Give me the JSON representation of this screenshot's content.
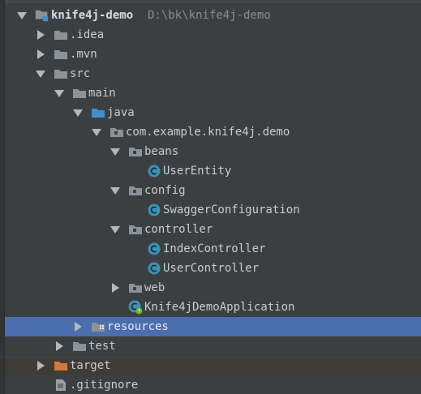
{
  "project": {
    "name": "knife4j-demo",
    "path": "D:\\bk\\knife4j-demo"
  },
  "tree": [
    {
      "label": "knife4j-demo",
      "level": 0,
      "toggle": "down",
      "icon": "module-folder-icon"
    },
    {
      "label": ".idea",
      "level": 1,
      "toggle": "right",
      "icon": "folder-icon"
    },
    {
      "label": ".mvn",
      "level": 1,
      "toggle": "right",
      "icon": "folder-icon"
    },
    {
      "label": "src",
      "level": 1,
      "toggle": "down",
      "icon": "folder-icon"
    },
    {
      "label": "main",
      "level": 2,
      "toggle": "down",
      "icon": "folder-icon"
    },
    {
      "label": "java",
      "level": 3,
      "toggle": "down",
      "icon": "source-folder-icon"
    },
    {
      "label": "com.example.knife4j.demo",
      "level": 4,
      "toggle": "down",
      "icon": "package-icon"
    },
    {
      "label": "beans",
      "level": 5,
      "toggle": "down",
      "icon": "package-icon"
    },
    {
      "label": "UserEntity",
      "level": 6,
      "toggle": "none",
      "icon": "class-icon"
    },
    {
      "label": "config",
      "level": 5,
      "toggle": "down",
      "icon": "package-icon"
    },
    {
      "label": "SwaggerConfiguration",
      "level": 6,
      "toggle": "none",
      "icon": "class-icon"
    },
    {
      "label": "controller",
      "level": 5,
      "toggle": "down",
      "icon": "package-icon"
    },
    {
      "label": "IndexController",
      "level": 6,
      "toggle": "none",
      "icon": "class-icon"
    },
    {
      "label": "UserController",
      "level": 6,
      "toggle": "none",
      "icon": "class-icon"
    },
    {
      "label": "web",
      "level": 5,
      "toggle": "right",
      "icon": "package-icon"
    },
    {
      "label": "Knife4jDemoApplication",
      "level": 5,
      "toggle": "none",
      "icon": "spring-boot-class-icon"
    },
    {
      "label": "resources",
      "level": 3,
      "toggle": "right",
      "icon": "resources-folder-icon",
      "selected": true
    },
    {
      "label": "test",
      "level": 2,
      "toggle": "right",
      "icon": "folder-icon"
    },
    {
      "label": "target",
      "level": 1,
      "toggle": "right",
      "icon": "excluded-folder-icon",
      "excluded": true
    },
    {
      "label": ".gitignore",
      "level": 1,
      "toggle": "none",
      "icon": "file-icon"
    }
  ],
  "colors": {
    "background": "#3c3f41",
    "selection": "#4b6eaf",
    "folder": "#8a9399",
    "source_folder": "#3d8fcf",
    "excluded_folder": "#d27a3a",
    "class_icon": "#3a93b5"
  }
}
